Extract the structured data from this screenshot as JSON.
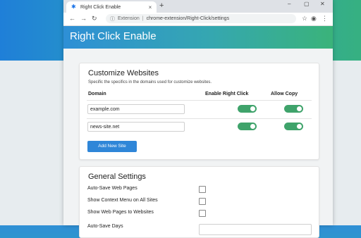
{
  "browser": {
    "tab_title": "Right Click Enable",
    "new_tab": "+",
    "close_tab": "×",
    "window_controls": [
      "–",
      "▢",
      "✕"
    ],
    "address": {
      "label": "Extension",
      "separator": "|",
      "url": "chrome-extension/Right-Click/settings"
    }
  },
  "header": {
    "title": "Right Click Enable"
  },
  "customize": {
    "title": "Customize Websites",
    "subtitle": "Specific the specifics in the domains used for customize websites.",
    "columns": [
      "Domain",
      "Enable Right Click",
      "Allow Copy"
    ],
    "rows": [
      {
        "domain": "example.com",
        "right_click": true,
        "allow_copy": true
      },
      {
        "domain": "news-site.net",
        "right_click": true,
        "allow_copy": true
      }
    ],
    "add_button": "Add New Site"
  },
  "general": {
    "title": "General Settings",
    "items": [
      {
        "label": "Auto-Save Web Pages",
        "checked": false
      },
      {
        "label": "Show Context Menu on All Sites",
        "checked": false
      },
      {
        "label": "Show Web Pages to Websites",
        "checked": false
      },
      {
        "label": "Auto-Save Days",
        "checked": false
      }
    ]
  },
  "colors": {
    "toggle_on": "#3fa36b",
    "button": "#2f86d8",
    "header_start": "#2e8fd6",
    "header_end": "#3ab37a"
  }
}
